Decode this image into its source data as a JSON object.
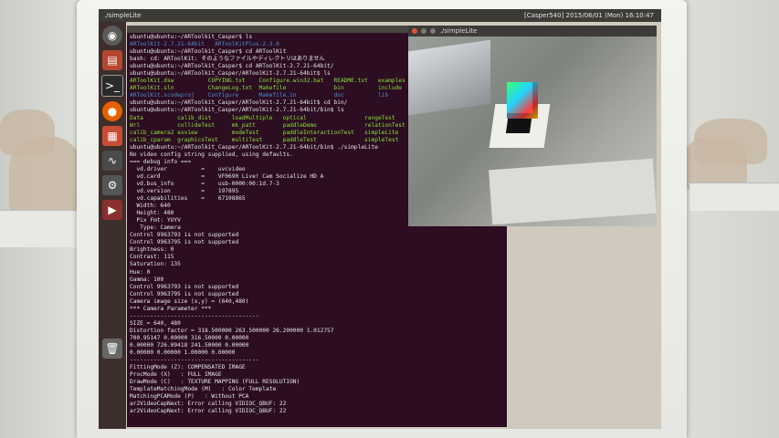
{
  "window": {
    "top_title": "./simpleLite",
    "top_status": "[Casper540] 2015/06/01 (Mon) 16:10:47",
    "camera_window_title": "./simpleLite"
  },
  "launcher": {
    "icons": [
      "ubuntu-icon",
      "files-icon",
      "terminal-icon",
      "firefox-icon",
      "document-icon",
      "system-monitor-icon",
      "settings-icon",
      "media-icon",
      "trash-icon"
    ]
  },
  "terminal": {
    "lines": [
      "ubuntu@ubuntu:~/ARToolkit_Casper$ ls",
      "ARToolKit-2.7.21-64bit   ARToolKitPlus-2.3.0",
      "ubuntu@ubuntu:~/ARToolkit_Casper$ cd ARToolKit",
      "bash: cd: ARToolKit: そのようなファイルやディレクトリはありません",
      "ubuntu@ubuntu:~/ARToolkit_Casper$ cd ARToolKit-2.7.21-64bit/",
      "ubuntu@ubuntu:~/ARToolkit_Casper/ARToolKit-2.7.21-64bit$ ls",
      "ARToolKit.dsw          COPYING.txt    Configure.win32.bat   README.txt   examples",
      "ARToolKit.sln          ChangeLog.txt  Makefile              bin          include",
      "ARToolKit.xcodeproj    Configure      Makefile.in           doc          lib",
      "ubuntu@ubuntu:~/ARToolkit_Casper/ARToolKit-2.7.21-64bit$ cd bin/",
      "ubuntu@ubuntu:~/ARToolkit_Casper/ARToolKit-2.7.21-64bit/bin$ ls",
      "Data          calib_dist      loadMultiple   optical                 rangeTest",
      "Wrl           collideTest     mk_patt        paddleDemo              relationTest",
      "calib_camera2 exview          modeTest       paddleInteractionTest   simpleLite",
      "calib_cparam  graphicsTest    multiTest      paddleTest              simpleTest",
      "ubuntu@ubuntu:~/ARToolkit_Casper/ARToolKit-2.7.21-64bit/bin$ ./simpleLite",
      "No video config string supplied, using defaults.",
      "=== debug info ===",
      "  vd.driver          =    uvcvideo",
      "  vd.card            =    VF0690 Live! Cam Socialize HD A",
      "  vd.bus_info        =    usb-0000:00:1d.7-3",
      "  vd.version         =    197895",
      "  vd.capabilities    =    67108865",
      "  Width: 640",
      "  Height: 480",
      "  Pix Fmt: YUYV",
      "   Type: Camera",
      "Control 9963793 is not supported",
      "Control 9963795 is not supported",
      "Brightness: 0",
      "Contrast: 115",
      "Saturation: 135",
      "Hue: 0",
      "Gamma: 100",
      "Control 9963793 is not supported",
      "Control 9963795 is not supported",
      "Camera image size (x,y) = (640,480)",
      "*** Camera Parameter ***",
      "--------------------------------------",
      "SIZE = 640, 480",
      "Distortion factor = 318.500000 263.500000 26.200000 1.012757",
      "700.95147 0.00000 316.50000 0.00000",
      "0.00000 726.09418 241.50000 0.00000",
      "0.00000 0.00000 1.00000 0.00000",
      "--------------------------------------",
      "FittingMode (Z): COMPENSATED IMAGE",
      "ProcMode (X)   : FULL IMAGE",
      "DrawMode (C)   : TEXTURE MAPPING (FULL RESOLUTION)",
      "TemplateMatchingMode (M)   : Color Template",
      "MatchingPCAMode (P)   : Without PCA",
      "ar2VideoCapNext: Error calling VIDIOC_QBUF: 22",
      "ar2VideoCapNext: Error calling VIDIOC_QBUF: 22"
    ]
  },
  "colors": {
    "terminal_bg": "#2c0d22",
    "launcher_bg": "#3d2f2b",
    "prompt_text": "#e7e7e7",
    "dir_blue": "#4e8dd0",
    "exec_green": "#8ae234"
  }
}
